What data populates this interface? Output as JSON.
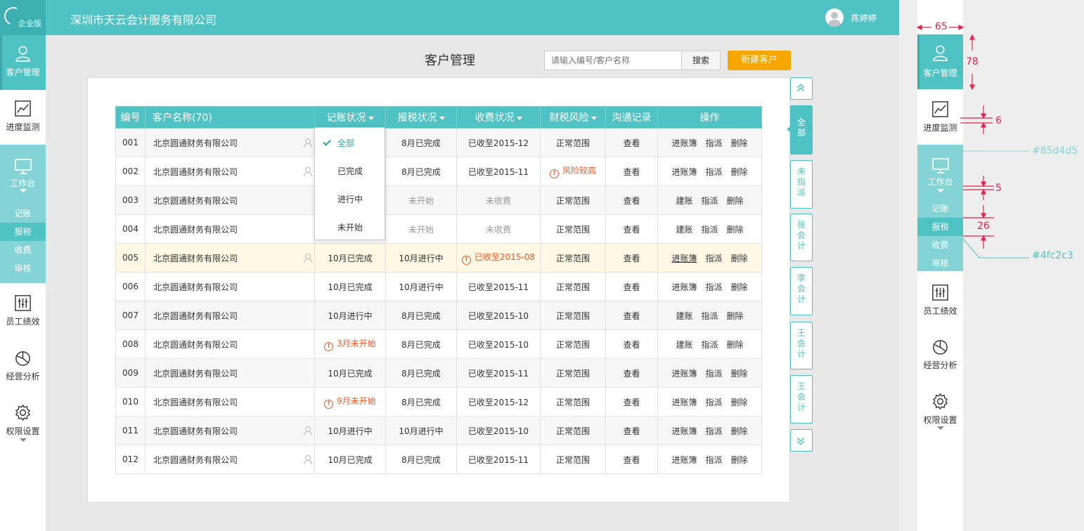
{
  "app": {
    "logo_text": "企业版",
    "company_name": "深圳市天云会计服务有限公司",
    "user_name": "陈婷婷"
  },
  "sidebar": {
    "items": [
      {
        "label": "客户管理",
        "icon": "user-icon"
      },
      {
        "label": "进度监测",
        "icon": "chart-icon"
      },
      {
        "label": "工作台",
        "icon": "monitor-icon"
      },
      {
        "label": "员工绩效",
        "icon": "sliders-icon"
      },
      {
        "label": "经营分析",
        "icon": "pie-icon"
      },
      {
        "label": "权限设置",
        "icon": "gear-icon"
      }
    ],
    "sub_items": [
      "记账",
      "报税",
      "收费",
      "审核"
    ]
  },
  "page": {
    "title": "客户管理",
    "search_placeholder": "请输入编号/客户名称",
    "search_label": "搜索",
    "new_client_label": "新建客户"
  },
  "table": {
    "headers": [
      "编号",
      "客户名称(70)",
      "记账状况",
      "报税状况",
      "收费状况",
      "财税风险",
      "沟通记录",
      "操作"
    ],
    "rows": [
      {
        "id": "001",
        "name": "北京圆通财务有限公司",
        "book": "",
        "tax": "8月已完成",
        "fee": "已收至2015-12",
        "risk": "正常范围",
        "comm": "查看",
        "op1": "进账簿",
        "op2": "指派",
        "op3": "删除"
      },
      {
        "id": "002",
        "name": "北京圆通财务有限公司",
        "book": "",
        "tax": "8月已完成",
        "fee": "已收至2015-11",
        "risk": "风险较高",
        "comm": "查看",
        "op1": "进账簿",
        "op2": "指派",
        "op3": "删除"
      },
      {
        "id": "003",
        "name": "北京圆通财务有限公司",
        "book": "",
        "tax": "未开始",
        "fee": "未收费",
        "risk": "正常范围",
        "comm": "查看",
        "op1": "建账",
        "op2": "指派",
        "op3": "删除"
      },
      {
        "id": "004",
        "name": "北京圆通财务有限公司",
        "book": "",
        "tax": "未开始",
        "fee": "未收费",
        "risk": "正常范围",
        "comm": "查看",
        "op1": "建账",
        "op2": "指派",
        "op3": "删除"
      },
      {
        "id": "005",
        "name": "北京圆通财务有限公司",
        "book": "10月已完成",
        "tax": "10月进行中",
        "fee": "已收至2015-08",
        "risk": "正常范围",
        "comm": "查看",
        "op1": "进账簿",
        "op2": "指派",
        "op3": "删除"
      },
      {
        "id": "006",
        "name": "北京圆通财务有限公司",
        "book": "10月已完成",
        "tax": "10月进行中",
        "fee": "已收至2015-11",
        "risk": "正常范围",
        "comm": "查看",
        "op1": "进账簿",
        "op2": "指派",
        "op3": "删除"
      },
      {
        "id": "007",
        "name": "北京圆通财务有限公司",
        "book": "10月进行中",
        "tax": "8月已完成",
        "fee": "已收至2015-10",
        "risk": "正常范围",
        "comm": "查看",
        "op1": "建账",
        "op2": "指派",
        "op3": "删除"
      },
      {
        "id": "008",
        "name": "北京圆通财务有限公司",
        "book": "3月未开始",
        "tax": "8月已完成",
        "fee": "已收至2015-10",
        "risk": "正常范围",
        "comm": "查看",
        "op1": "建账",
        "op2": "指派",
        "op3": "删除"
      },
      {
        "id": "009",
        "name": "北京圆通财务有限公司",
        "book": "10月已完成",
        "tax": "8月已完成",
        "fee": "已收至2015-11",
        "risk": "正常范围",
        "comm": "查看",
        "op1": "进账簿",
        "op2": "指派",
        "op3": "删除"
      },
      {
        "id": "010",
        "name": "北京圆通财务有限公司",
        "book": "9月未开始",
        "tax": "8月已完成",
        "fee": "已收至2015-12",
        "risk": "正常范围",
        "comm": "查看",
        "op1": "进账簿",
        "op2": "指派",
        "op3": "删除"
      },
      {
        "id": "011",
        "name": "北京圆通财务有限公司",
        "book": "10月进行中",
        "tax": "10月进行中",
        "fee": "已收至2015-10",
        "risk": "正常范围",
        "comm": "查看",
        "op1": "进账簿",
        "op2": "指派",
        "op3": "删除"
      },
      {
        "id": "012",
        "name": "北京圆通财务有限公司",
        "book": "10月已完成",
        "tax": "8月已完成",
        "fee": "已收至2015-11",
        "risk": "正常范围",
        "comm": "查看",
        "op1": "进账簿",
        "op2": "指派",
        "op3": "删除"
      }
    ]
  },
  "dropdown": {
    "options": [
      "全部",
      "已完成",
      "进行中",
      "未开始"
    ],
    "selected": "全部"
  },
  "side_tabs": [
    "全部",
    "未指派",
    "张会计",
    "李会计",
    "王会计",
    "王会计"
  ],
  "spec": {
    "width_label": "65",
    "height_label": "78",
    "gap_label": "6",
    "gap2_label": "5",
    "sub_height_label": "26",
    "color_light": "#85d4d5",
    "color_dark": "#4fc2c3"
  },
  "colors": {
    "accent": "#4fc2c3",
    "accent_light": "#85d4d5",
    "orange_button": "#f5a700",
    "warning": "#f05a28",
    "spec_red": "#e8234a"
  }
}
